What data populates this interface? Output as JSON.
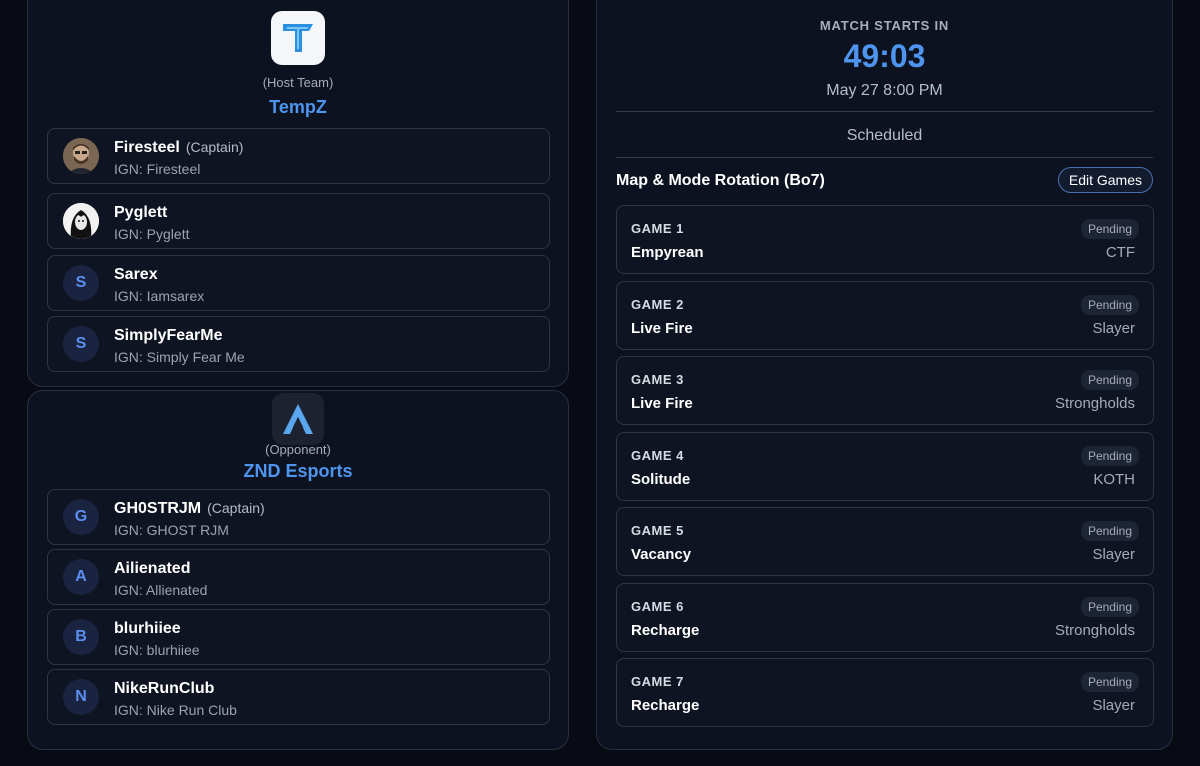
{
  "host_team": {
    "role": "(Host Team)",
    "name": "TempZ",
    "players": [
      {
        "name": "Firesteel",
        "captain": "(Captain)",
        "ign": "IGN: Firesteel",
        "initial": ""
      },
      {
        "name": "Pyglett",
        "captain": "",
        "ign": "IGN: Pyglett",
        "initial": ""
      },
      {
        "name": "Sarex",
        "captain": "",
        "ign": "IGN: Iamsarex",
        "initial": "S"
      },
      {
        "name": "SimplyFearMe",
        "captain": "",
        "ign": "IGN: Simply Fear Me",
        "initial": "S"
      }
    ]
  },
  "opponent_team": {
    "role": "(Opponent)",
    "name": "ZND Esports",
    "players": [
      {
        "name": "GH0STRJM",
        "captain": "(Captain)",
        "ign": "IGN: GHOST RJM",
        "initial": "G"
      },
      {
        "name": "Ailienated",
        "captain": "",
        "ign": "IGN: Allienated",
        "initial": "A"
      },
      {
        "name": "blurhiiee",
        "captain": "",
        "ign": "IGN: blurhiiee",
        "initial": "B"
      },
      {
        "name": "NikeRunClub",
        "captain": "",
        "ign": "IGN: Nike Run Club",
        "initial": "N"
      }
    ]
  },
  "match": {
    "starts_label": "MATCH STARTS IN",
    "countdown": "49:03",
    "datetime": "May 27 8:00 PM",
    "status": "Scheduled",
    "rotation_title": "Map & Mode Rotation (Bo7)",
    "edit_label": "Edit Games",
    "games": [
      {
        "label": "GAME 1",
        "map": "Empyrean",
        "mode": "CTF",
        "status": "Pending"
      },
      {
        "label": "GAME 2",
        "map": "Live Fire",
        "mode": "Slayer",
        "status": "Pending"
      },
      {
        "label": "GAME 3",
        "map": "Live Fire",
        "mode": "Strongholds",
        "status": "Pending"
      },
      {
        "label": "GAME 4",
        "map": "Solitude",
        "mode": "KOTH",
        "status": "Pending"
      },
      {
        "label": "GAME 5",
        "map": "Vacancy",
        "mode": "Slayer",
        "status": "Pending"
      },
      {
        "label": "GAME 6",
        "map": "Recharge",
        "mode": "Strongholds",
        "status": "Pending"
      },
      {
        "label": "GAME 7",
        "map": "Recharge",
        "mode": "Slayer",
        "status": "Pending"
      }
    ]
  },
  "colors": {
    "accent": "#4d95ee",
    "background": "#080b13",
    "panel": "#0d1220"
  },
  "icons": {
    "host_logo": "tempz-logo",
    "opponent_logo": "znd-esports-logo"
  }
}
